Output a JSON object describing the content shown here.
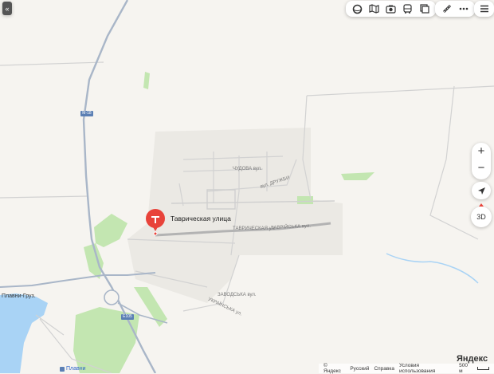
{
  "map": {
    "pin_label": "Таврическая улица",
    "highway_labels": [
      "М-18",
      "Е105"
    ],
    "place_labels": {
      "plavni_gruz": "Плавни-Груз.",
      "plavni": "Плавни",
      "street_chudova": "ЧУДОВА вул.",
      "street_druzhby": "вул. ДРУЖБИ",
      "street_tavricheskaya": "ТАВРИЧЕСКАЯ ул.",
      "street_tavriiska": "ТАВРІЙСЬКА вул.",
      "street_zavodskaya": "ЗАВОДСЬКА вул.",
      "street_ukrainska": "УКРАЇНСЬКА ул."
    }
  },
  "controls": {
    "collapse_label": "«",
    "zoom_in": "+",
    "zoom_out": "−",
    "mode_3d": "3D"
  },
  "toolbar": {
    "icons": [
      "layers-icon",
      "map-icon",
      "camera-icon",
      "bus-icon",
      "panorama-icon"
    ],
    "ruler_icon": "ruler-icon",
    "more_icon": "more-icon",
    "menu_icon": "menu-icon"
  },
  "footer": {
    "brand": "Яндекс",
    "yandex_small": "© Яндекс",
    "language": "Русский",
    "help": "Справка",
    "terms": "Условия использования",
    "scale": "500 м"
  },
  "colors": {
    "background": "#f5f3ef",
    "road_major": "#a9b6c8",
    "road_minor": "#c8c8c8",
    "water": "#a9d3f5",
    "park": "#c3e6b1",
    "pin": "#e8433a",
    "brand": "#f33"
  }
}
